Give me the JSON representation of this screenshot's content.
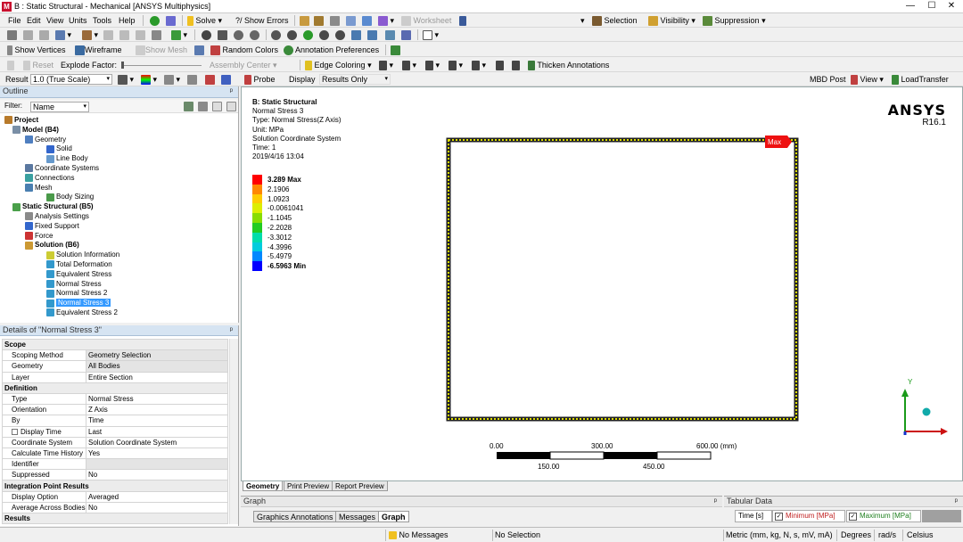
{
  "window": {
    "title": "B : Static Structural - Mechanical [ANSYS Multiphysics]",
    "app_icon_letter": "M",
    "minimize": "—",
    "maximize": "☐",
    "close": "✕"
  },
  "menu": [
    "File",
    "Edit",
    "View",
    "Units",
    "Tools",
    "Help"
  ],
  "toolbar1": {
    "solve": "Solve",
    "show_errors": "?/ Show Errors",
    "worksheet": "Worksheet",
    "selection": "Selection",
    "visibility": "Visibility",
    "suppression": "Suppression"
  },
  "toolbar3": {
    "show_vertices": "Show Vertices",
    "wireframe": "Wireframe",
    "show_mesh": "Show Mesh",
    "random_colors": "Random Colors",
    "annotation_preferences": "Annotation Preferences"
  },
  "toolbar4": {
    "reset": "Reset",
    "explode_factor": "Explode Factor:",
    "assembly_center": "Assembly Center",
    "edge_coloring": "Edge Coloring",
    "thicken_annotations": "Thicken Annotations"
  },
  "toolbar5": {
    "result_label": "Result",
    "result_scale": "1.0 (True Scale)",
    "probe": "Probe",
    "display": "Display",
    "results_only": "Results Only",
    "mbd_post": "MBD Post",
    "view": "View",
    "load_transfer": "LoadTransfer"
  },
  "outline": {
    "header": "Outline",
    "pin": "ᵖ",
    "filter_label": "Filter:",
    "filter_value": "Name",
    "items": [
      {
        "label": "Project",
        "level": 0,
        "bold": true,
        "color": "#b87a2a"
      },
      {
        "label": "Model (B4)",
        "level": 1,
        "bold": true,
        "color": "#7a8fa6"
      },
      {
        "label": "Geometry",
        "level": 2,
        "bold": false,
        "color": "#4f7fc0"
      },
      {
        "label": "Solid",
        "level": 3,
        "bold": false,
        "color": "#3366cc"
      },
      {
        "label": "Line Body",
        "level": 3,
        "bold": false,
        "color": "#6699cc"
      },
      {
        "label": "Coordinate Systems",
        "level": 2,
        "bold": false,
        "color": "#5a78a0"
      },
      {
        "label": "Connections",
        "level": 2,
        "bold": false,
        "color": "#3aa0a0"
      },
      {
        "label": "Mesh",
        "level": 2,
        "bold": false,
        "color": "#4a7fb0"
      },
      {
        "label": "Body Sizing",
        "level": 3,
        "bold": false,
        "color": "#4a9a4a"
      },
      {
        "label": "Static Structural (B5)",
        "level": 1,
        "bold": true,
        "color": "#4aa04a"
      },
      {
        "label": "Analysis Settings",
        "level": 2,
        "bold": false,
        "color": "#8a8a8a"
      },
      {
        "label": "Fixed Support",
        "level": 2,
        "bold": false,
        "color": "#3366cc"
      },
      {
        "label": "Force",
        "level": 2,
        "bold": false,
        "color": "#cc3333"
      },
      {
        "label": "Solution (B6)",
        "level": 2,
        "bold": true,
        "color": "#cc9933"
      },
      {
        "label": "Solution Information",
        "level": 3,
        "bold": false,
        "color": "#cccc33"
      },
      {
        "label": "Total Deformation",
        "level": 3,
        "bold": false,
        "color": "#3399cc"
      },
      {
        "label": "Equivalent Stress",
        "level": 3,
        "bold": false,
        "color": "#3399cc"
      },
      {
        "label": "Normal Stress",
        "level": 3,
        "bold": false,
        "color": "#3399cc"
      },
      {
        "label": "Normal Stress 2",
        "level": 3,
        "bold": false,
        "color": "#3399cc"
      },
      {
        "label": "Normal Stress 3",
        "level": 3,
        "bold": false,
        "color": "#3399cc",
        "selected": true
      },
      {
        "label": "Equivalent Stress 2",
        "level": 3,
        "bold": false,
        "color": "#3399cc"
      }
    ]
  },
  "details": {
    "header": "Details of \"Normal Stress 3\"",
    "rows": [
      {
        "section": true,
        "label": "Scope"
      },
      {
        "label": "Scoping Method",
        "value": "Geometry Selection",
        "hi": true
      },
      {
        "label": "Geometry",
        "value": "All Bodies",
        "hi": true
      },
      {
        "label": "Layer",
        "value": "Entire Section"
      },
      {
        "section": true,
        "label": "Definition"
      },
      {
        "label": "Type",
        "value": "Normal Stress"
      },
      {
        "label": "Orientation",
        "value": "Z Axis"
      },
      {
        "label": "By",
        "value": "Time"
      },
      {
        "label": "Display Time",
        "value": "Last",
        "checkbox": true
      },
      {
        "label": "Coordinate System",
        "value": "Solution Coordinate System"
      },
      {
        "label": "Calculate Time History",
        "value": "Yes"
      },
      {
        "label": "Identifier",
        "value": "",
        "hi": true
      },
      {
        "label": "Suppressed",
        "value": "No"
      },
      {
        "section": true,
        "label": "Integration Point Results"
      },
      {
        "label": "Display Option",
        "value": "Averaged"
      },
      {
        "label": "Average Across Bodies",
        "value": "No"
      },
      {
        "section": true,
        "label": "Results"
      }
    ]
  },
  "viewport": {
    "info": [
      "B: Static Structural",
      "Normal Stress 3",
      "Type: Normal Stress(Z Axis)",
      "Unit: MPa",
      "Solution Coordinate System",
      "Time: 1",
      "2019/4/16 13:04"
    ],
    "legend": [
      {
        "label": "3.289 Max",
        "color": "#ff0000",
        "bold": true
      },
      {
        "label": "2.1906",
        "color": "#ff8800"
      },
      {
        "label": "1.0923",
        "color": "#ffcc00"
      },
      {
        "label": "-0.0061041",
        "color": "#ddee00"
      },
      {
        "label": "-1.1045",
        "color": "#88dd00"
      },
      {
        "label": "-2.2028",
        "color": "#22cc22"
      },
      {
        "label": "-3.3012",
        "color": "#00ddaa"
      },
      {
        "label": "-4.3996",
        "color": "#00ccdd"
      },
      {
        "label": "-5.4979",
        "color": "#0088ff"
      },
      {
        "label": "-6.5963 Min",
        "color": "#0000ff",
        "bold": true
      }
    ],
    "brand": "ANSYS",
    "version": "R16.1",
    "max_tag": "Max",
    "scale_top": [
      "0.00",
      "300.00",
      "600.00 (mm)"
    ],
    "scale_bottom": [
      "150.00",
      "450.00"
    ],
    "triad_y": "Y",
    "model_color": "#e0e000"
  },
  "bottom_tabs": [
    "Geometry",
    "Print Preview",
    "Report Preview"
  ],
  "graph": {
    "header": "Graph",
    "pin": "ᵖ",
    "tabs": [
      "Graphics Annotations",
      "Messages",
      "Graph"
    ]
  },
  "tabular": {
    "header": "Tabular Data",
    "pin": "ᵖ",
    "time_col": "Time [s]",
    "min_col": "Minimum [MPa]",
    "max_col": "Maximum [MPa]"
  },
  "status": {
    "messages": "No Messages",
    "selection": "No Selection",
    "units": "Metric (mm, kg, N, s, mV, mA)",
    "degrees": "Degrees",
    "rads": "rad/s",
    "temp": "Celsius"
  }
}
